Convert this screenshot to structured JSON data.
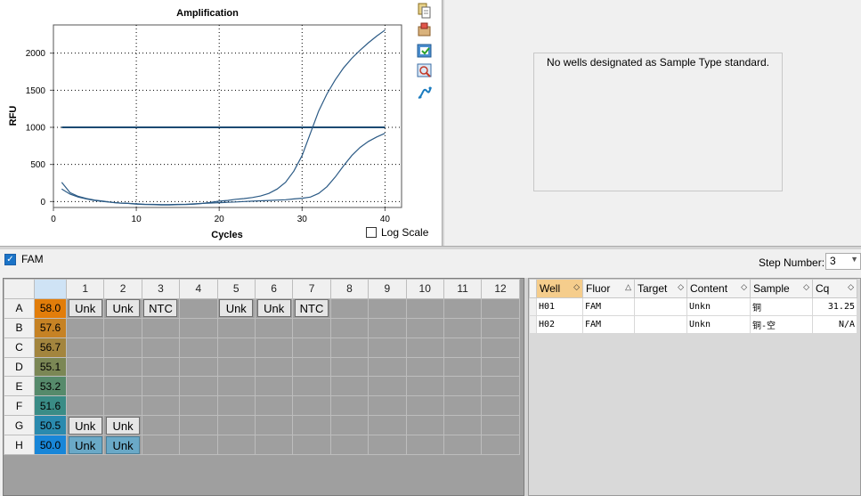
{
  "chart": {
    "title": "Amplification",
    "xlabel": "Cycles",
    "ylabel": "RFU",
    "log_scale_label": "Log Scale"
  },
  "chart_data": {
    "type": "line",
    "title": "Amplification",
    "xlabel": "Cycles",
    "ylabel": "RFU",
    "xlim": [
      0,
      42
    ],
    "ylim": [
      -80,
      2380
    ],
    "xticks": [
      0,
      10,
      20,
      30,
      40
    ],
    "yticks": [
      0,
      500,
      1000,
      1500,
      2000
    ],
    "grid": true,
    "threshold": 1000,
    "series": [
      {
        "x": [
          1,
          2,
          3,
          4,
          5,
          6,
          7,
          8,
          9,
          10,
          11,
          12,
          13,
          14,
          15,
          16,
          17,
          18,
          19,
          20,
          21,
          22,
          23,
          24,
          25,
          26,
          27,
          28,
          29,
          30,
          31,
          32,
          33,
          34,
          35,
          36,
          37,
          38,
          39,
          40
        ],
        "values": [
          260,
          120,
          70,
          40,
          20,
          5,
          -10,
          -20,
          -25,
          -35,
          -40,
          -42,
          -45,
          -45,
          -42,
          -40,
          -35,
          -25,
          -10,
          5,
          15,
          30,
          40,
          55,
          75,
          110,
          170,
          260,
          410,
          620,
          920,
          1220,
          1450,
          1640,
          1800,
          1930,
          2040,
          2140,
          2230,
          2310
        ]
      },
      {
        "x": [
          1,
          2,
          3,
          4,
          5,
          6,
          7,
          8,
          9,
          10,
          11,
          12,
          13,
          14,
          15,
          16,
          17,
          18,
          19,
          20,
          21,
          22,
          23,
          24,
          25,
          26,
          27,
          28,
          29,
          30,
          31,
          32,
          33,
          34,
          35,
          36,
          37,
          38,
          39,
          40
        ],
        "values": [
          170,
          100,
          60,
          35,
          15,
          0,
          -10,
          -20,
          -25,
          -30,
          -35,
          -38,
          -40,
          -40,
          -38,
          -35,
          -30,
          -25,
          -20,
          -15,
          -10,
          -5,
          0,
          5,
          10,
          15,
          20,
          25,
          35,
          45,
          60,
          110,
          200,
          330,
          480,
          620,
          730,
          810,
          870,
          920
        ]
      }
    ]
  },
  "standard_panel": {
    "message": "No wells designated as Sample Type standard."
  },
  "fluor_bar": {
    "fam_label": "FAM",
    "step_label": "Step Number:",
    "step_value": "3"
  },
  "plate": {
    "columns": [
      "1",
      "2",
      "3",
      "4",
      "5",
      "6",
      "7",
      "8",
      "9",
      "10",
      "11",
      "12"
    ],
    "rows": [
      {
        "label": "A",
        "temp": "58.0",
        "color": "#e27d0a",
        "wells": [
          "Unk",
          "Unk",
          "NTC",
          "",
          "Unk",
          "Unk",
          "NTC",
          "",
          "",
          "",
          "",
          ""
        ]
      },
      {
        "label": "B",
        "temp": "57.6",
        "color": "#c68224",
        "wells": [
          "",
          "",
          "",
          "",
          "",
          "",
          "",
          "",
          "",
          "",
          "",
          ""
        ]
      },
      {
        "label": "C",
        "temp": "56.7",
        "color": "#a3853e",
        "wells": [
          "",
          "",
          "",
          "",
          "",
          "",
          "",
          "",
          "",
          "",
          "",
          ""
        ]
      },
      {
        "label": "D",
        "temp": "55.1",
        "color": "#7b8755",
        "wells": [
          "",
          "",
          "",
          "",
          "",
          "",
          "",
          "",
          "",
          "",
          "",
          ""
        ]
      },
      {
        "label": "E",
        "temp": "53.2",
        "color": "#568a6b",
        "wells": [
          "",
          "",
          "",
          "",
          "",
          "",
          "",
          "",
          "",
          "",
          "",
          ""
        ]
      },
      {
        "label": "F",
        "temp": "51.6",
        "color": "#3a8c86",
        "wells": [
          "",
          "",
          "",
          "",
          "",
          "",
          "",
          "",
          "",
          "",
          "",
          ""
        ]
      },
      {
        "label": "G",
        "temp": "50.5",
        "color": "#2a8aae",
        "wells": [
          "Unk",
          "Unk",
          "",
          "",
          "",
          "",
          "",
          "",
          "",
          "",
          "",
          ""
        ]
      },
      {
        "label": "H",
        "temp": "50.0",
        "color": "#1886d8",
        "wells": [
          "Unk",
          "Unk",
          "",
          "",
          "",
          "",
          "",
          "",
          "",
          "",
          "",
          ""
        ],
        "selected": [
          true,
          true
        ]
      }
    ]
  },
  "well_table": {
    "columns": [
      "Well",
      "Fluor",
      "Target",
      "Content",
      "Sample",
      "Cq"
    ],
    "rows": [
      [
        "H01",
        "FAM",
        "",
        "Unkn",
        "铜",
        "31.25"
      ],
      [
        "H02",
        "FAM",
        "",
        "Unkn",
        "铜-空",
        "N/A"
      ]
    ]
  },
  "colors": {
    "curve": "#2b5a85",
    "threshold": "#1c4a72",
    "grid": "#000000"
  },
  "icons": [
    "copy-icon",
    "export-icon",
    "save-image-icon",
    "zoom-icon",
    "curve-settings-icon"
  ]
}
